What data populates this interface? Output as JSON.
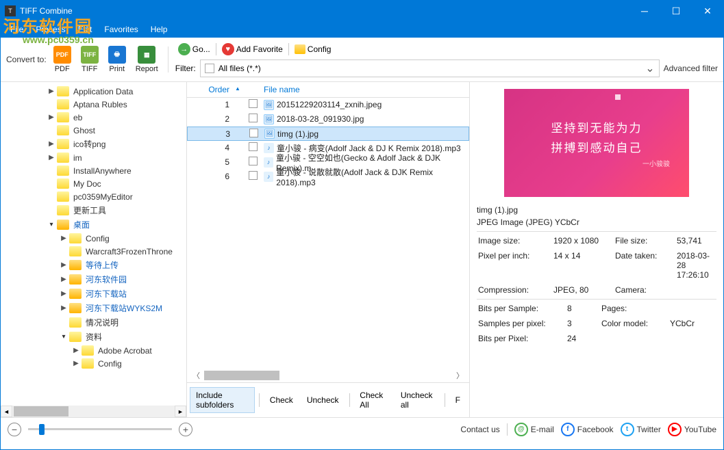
{
  "window": {
    "title": "TIFF Combine"
  },
  "menubar": [
    "File",
    "Process",
    "Edit",
    "Favorites",
    "Help"
  ],
  "watermark": {
    "cn": "河东软件园",
    "url": "www.pc0359.cn"
  },
  "toolbar": {
    "convert_label": "Convert to:",
    "pdf": "PDF",
    "tiff": "TIFF",
    "print": "Print",
    "report": "Report",
    "go": "Go...",
    "add_fav": "Add Favorite",
    "config": "Config"
  },
  "filter": {
    "label": "Filter:",
    "value": "All files (*.*)",
    "advanced": "Advanced filter"
  },
  "tree": [
    {
      "indent": 2,
      "chev": "▶",
      "name": "Application Data"
    },
    {
      "indent": 2,
      "chev": "",
      "name": "Aptana Rubles"
    },
    {
      "indent": 2,
      "chev": "▶",
      "name": "eb"
    },
    {
      "indent": 2,
      "chev": "",
      "name": "Ghost"
    },
    {
      "indent": 2,
      "chev": "▶",
      "name": "ico转png"
    },
    {
      "indent": 2,
      "chev": "▶",
      "name": "im"
    },
    {
      "indent": 2,
      "chev": "",
      "name": "InstallAnywhere"
    },
    {
      "indent": 2,
      "chev": "",
      "name": "My Doc"
    },
    {
      "indent": 2,
      "chev": "",
      "name": "pc0359MyEditor"
    },
    {
      "indent": 2,
      "chev": "",
      "name": "更新工具"
    },
    {
      "indent": 2,
      "chev": "▾",
      "name": "桌面",
      "blue": true,
      "exp": true
    },
    {
      "indent": 3,
      "chev": "▶",
      "name": "Config"
    },
    {
      "indent": 3,
      "chev": "",
      "name": "Warcraft3FrozenThrone"
    },
    {
      "indent": 3,
      "chev": "▶",
      "name": "等待上传",
      "blue": true
    },
    {
      "indent": 3,
      "chev": "▶",
      "name": "河东软件园",
      "blue": true
    },
    {
      "indent": 3,
      "chev": "▶",
      "name": "河东下载站",
      "blue": true
    },
    {
      "indent": 3,
      "chev": "▶",
      "name": "河东下载站WYKS2M",
      "blue": true
    },
    {
      "indent": 3,
      "chev": "",
      "name": "情况说明"
    },
    {
      "indent": 3,
      "chev": "▾",
      "name": "资料",
      "exp": true
    },
    {
      "indent": 4,
      "chev": "▶",
      "name": "Adobe Acrobat"
    },
    {
      "indent": 4,
      "chev": "▶",
      "name": "Config"
    }
  ],
  "list": {
    "cols": {
      "order": "Order",
      "filename": "File name"
    },
    "rows": [
      {
        "n": 1,
        "type": "img",
        "name": "20151229203114_zxnih.jpeg"
      },
      {
        "n": 2,
        "type": "img",
        "name": "2018-03-28_091930.jpg"
      },
      {
        "n": 3,
        "type": "img",
        "name": "timg (1).jpg",
        "sel": true
      },
      {
        "n": 4,
        "type": "aud",
        "name": "童小骏 - 病变(Adolf Jack & DJ K Remix 2018).mp3"
      },
      {
        "n": 5,
        "type": "aud",
        "name": "童小骏 - 空空如也(Gecko & Adolf Jack & DJK Remix).m"
      },
      {
        "n": 6,
        "type": "aud",
        "name": "童小骏 - 说散就散(Adolf Jack & DJK Remix 2018).mp3"
      }
    ],
    "actions": {
      "include": "Include subfolders",
      "check": "Check",
      "uncheck": "Uncheck",
      "check_all": "Check All",
      "uncheck_all": "Uncheck all",
      "f": "F"
    }
  },
  "preview": {
    "line1": "坚持到无能为力",
    "line2": "拼搏到感动自己",
    "sig": "一小骏骏",
    "filename": "timg (1).jpg",
    "format": "JPEG Image (JPEG) YCbCr",
    "props": {
      "image_size_l": "Image size:",
      "image_size": "1920 x 1080",
      "file_size_l": "File size:",
      "file_size": "53,741",
      "ppi_l": "Pixel per inch:",
      "ppi": "14 x 14",
      "date_l": "Date taken:",
      "date": "2018-03-28 17:26:10",
      "comp_l": "Compression:",
      "comp": "JPEG, 80",
      "cam_l": "Camera:",
      "cam": "",
      "bps_l": "Bits per Sample:",
      "bps": "8",
      "pages_l": "Pages:",
      "pages": "",
      "spp_l": "Samples per pixel:",
      "spp": "3",
      "cm_l": "Color model:",
      "cm": "YCbCr",
      "bpp_l": "Bits per Pixel:",
      "bpp": "24"
    }
  },
  "footer": {
    "contact": "Contact us",
    "email": "E-mail",
    "facebook": "Facebook",
    "twitter": "Twitter",
    "youtube": "YouTube"
  }
}
